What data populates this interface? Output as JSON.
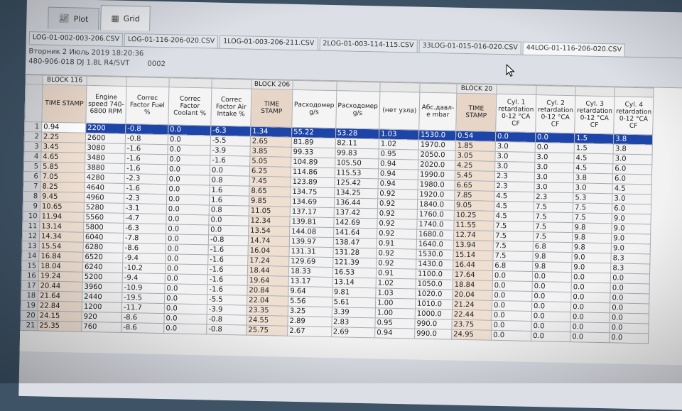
{
  "view_tabs": [
    {
      "label": "Plot",
      "icon": "plot-icon"
    },
    {
      "label": "Grid",
      "icon": "grid-icon"
    }
  ],
  "file_tabs": [
    "LOG-01-002-003-206.CSV",
    "LOG-01-116-206-020.CSV",
    "1LOG-01-003-206-211.CSV",
    "2LOG-01-003-114-115.CSV",
    "33LOG-01-015-016-020.CSV",
    "44LOG-01-116-206-020.CSV"
  ],
  "active_file_tab": 5,
  "info": {
    "date": "Вторник 2 Июль 2019 18:20:36",
    "vehicle": "480-906-018 DJ  1.8L R4/5VT",
    "code": "0002"
  },
  "grid": {
    "blocks": [
      {
        "label": "BLOCK 116",
        "span": 5
      },
      {
        "label": "BLOCK 206",
        "span": 5
      },
      {
        "label": "BLOCK 20",
        "span": 5
      }
    ],
    "columns": [
      {
        "label": "TIME STAMP",
        "width": 62,
        "shade": true
      },
      {
        "label": "Engine speed 740-6800 RPM",
        "width": 56
      },
      {
        "label": "Correc Factor Fuel %",
        "width": 60
      },
      {
        "label": "Correc Factor Coolant %",
        "width": 60
      },
      {
        "label": "Correc Factor Air Intake %",
        "width": 56
      },
      {
        "label": "TIME STAMP",
        "width": 58,
        "shade": true
      },
      {
        "label": "Расходомер g/s",
        "width": 56
      },
      {
        "label": "Расходомер g/s",
        "width": 56
      },
      {
        "label": "(нет узла)",
        "width": 56
      },
      {
        "label": "Абс.давл-е mbar",
        "width": 52
      },
      {
        "label": "TIME STAMP",
        "width": 56,
        "shade": true
      },
      {
        "label": "Cyl. 1 retardation 0-12 °CA CF",
        "width": 56
      },
      {
        "label": "Cyl. 2 retardation 0-12 °CA CF",
        "width": 50
      },
      {
        "label": "Cyl. 3 retardation 0-12 °CA CF",
        "width": 52
      },
      {
        "label": "Cyl. 4 retardation 0-12 °CA CF",
        "width": 52
      }
    ],
    "rows": [
      [
        "0.94",
        "2200",
        "-0.8",
        "0.0",
        "-6.3",
        "1.34",
        "55.22",
        "53.28",
        "1.03",
        "1530.0",
        "0.54",
        "0.0",
        "0.0",
        "1.5",
        "3.8"
      ],
      [
        "2.25",
        "2600",
        "-0.8",
        "0.0",
        "-5.5",
        "2.65",
        "81.89",
        "82.11",
        "1.02",
        "1970.0",
        "1.85",
        "3.0",
        "0.0",
        "1.5",
        "3.8"
      ],
      [
        "3.45",
        "3080",
        "-1.6",
        "0.0",
        "-3.9",
        "3.85",
        "99.33",
        "99.83",
        "0.95",
        "2050.0",
        "3.05",
        "3.0",
        "3.0",
        "4.5",
        "3.0"
      ],
      [
        "4.65",
        "3480",
        "-1.6",
        "0.0",
        "-1.6",
        "5.05",
        "104.89",
        "105.50",
        "0.94",
        "2020.0",
        "4.25",
        "3.0",
        "3.0",
        "4.5",
        "6.0"
      ],
      [
        "5.85",
        "3880",
        "-1.6",
        "0.0",
        "0.0",
        "6.25",
        "114.86",
        "115.53",
        "0.94",
        "1990.0",
        "5.45",
        "2.3",
        "3.0",
        "3.8",
        "6.0"
      ],
      [
        "7.05",
        "4280",
        "-2.3",
        "0.0",
        "0.8",
        "7.45",
        "123.89",
        "125.42",
        "0.94",
        "1980.0",
        "6.65",
        "2.3",
        "3.0",
        "3.0",
        "4.5"
      ],
      [
        "8.25",
        "4640",
        "-1.6",
        "0.0",
        "1.6",
        "8.65",
        "134.75",
        "134.25",
        "0.92",
        "1920.0",
        "7.85",
        "4.5",
        "2.3",
        "5.3",
        "3.0"
      ],
      [
        "9.45",
        "4960",
        "-2.3",
        "0.0",
        "1.6",
        "9.85",
        "134.69",
        "136.44",
        "0.92",
        "1840.0",
        "9.05",
        "4.5",
        "7.5",
        "7.5",
        "6.0"
      ],
      [
        "10.65",
        "5280",
        "-3.1",
        "0.0",
        "0.8",
        "11.05",
        "137.17",
        "137.42",
        "0.92",
        "1760.0",
        "10.25",
        "4.5",
        "7.5",
        "7.5",
        "9.0"
      ],
      [
        "11.94",
        "5560",
        "-4.7",
        "0.0",
        "0.0",
        "12.34",
        "139.81",
        "142.69",
        "0.92",
        "1740.0",
        "11.55",
        "7.5",
        "7.5",
        "9.8",
        "9.0"
      ],
      [
        "13.14",
        "5800",
        "-6.3",
        "0.0",
        "0.0",
        "13.54",
        "144.08",
        "141.64",
        "0.92",
        "1680.0",
        "12.74",
        "7.5",
        "7.5",
        "9.8",
        "9.0"
      ],
      [
        "14.34",
        "6040",
        "-7.8",
        "0.0",
        "-0.8",
        "14.74",
        "139.97",
        "138.47",
        "0.91",
        "1640.0",
        "13.94",
        "7.5",
        "6.8",
        "9.8",
        "9.0"
      ],
      [
        "15.54",
        "6280",
        "-8.6",
        "0.0",
        "-1.6",
        "16.04",
        "131.31",
        "131.28",
        "0.92",
        "1530.0",
        "15.14",
        "7.5",
        "9.8",
        "9.0",
        "8.3"
      ],
      [
        "16.84",
        "6520",
        "-9.4",
        "0.0",
        "-1.6",
        "17.24",
        "129.69",
        "121.39",
        "0.92",
        "1430.0",
        "16.44",
        "6.8",
        "9.8",
        "9.0",
        "8.3"
      ],
      [
        "18.04",
        "6240",
        "-10.2",
        "0.0",
        "-1.6",
        "18.44",
        "18.33",
        "16.53",
        "0.91",
        "1100.0",
        "17.64",
        "0.0",
        "0.0",
        "0.0",
        "0.0"
      ],
      [
        "19.24",
        "5200",
        "-9.4",
        "0.0",
        "-1.6",
        "19.64",
        "13.17",
        "13.14",
        "1.02",
        "1050.0",
        "18.84",
        "0.0",
        "0.0",
        "0.0",
        "0.0"
      ],
      [
        "20.44",
        "3960",
        "-10.9",
        "0.0",
        "-1.6",
        "20.84",
        "9.64",
        "9.81",
        "1.03",
        "1020.0",
        "20.04",
        "0.0",
        "0.0",
        "0.0",
        "0.0"
      ],
      [
        "21.64",
        "2440",
        "-19.5",
        "0.0",
        "-5.5",
        "22.04",
        "5.56",
        "5.61",
        "1.00",
        "1010.0",
        "21.24",
        "0.0",
        "0.0",
        "0.0",
        "0.0"
      ],
      [
        "22.84",
        "1200",
        "-11.7",
        "0.0",
        "-3.9",
        "23.35",
        "3.25",
        "3.39",
        "1.00",
        "1000.0",
        "22.44",
        "0.0",
        "0.0",
        "0.0",
        "0.0"
      ],
      [
        "24.15",
        "920",
        "-8.6",
        "0.0",
        "-0.8",
        "24.55",
        "2.89",
        "2.83",
        "0.95",
        "990.0",
        "23.75",
        "0.0",
        "0.0",
        "0.0",
        "0.0"
      ],
      [
        "25.35",
        "760",
        "-8.6",
        "0.0",
        "-0.8",
        "25.75",
        "2.67",
        "2.69",
        "0.94",
        "990.0",
        "24.95",
        "0.0",
        "0.0",
        "0.0",
        "0.0"
      ]
    ],
    "selected_row": 0,
    "colors": {
      "selection": "#1d44a8",
      "timestamp_shade": "#efdfd1"
    }
  }
}
